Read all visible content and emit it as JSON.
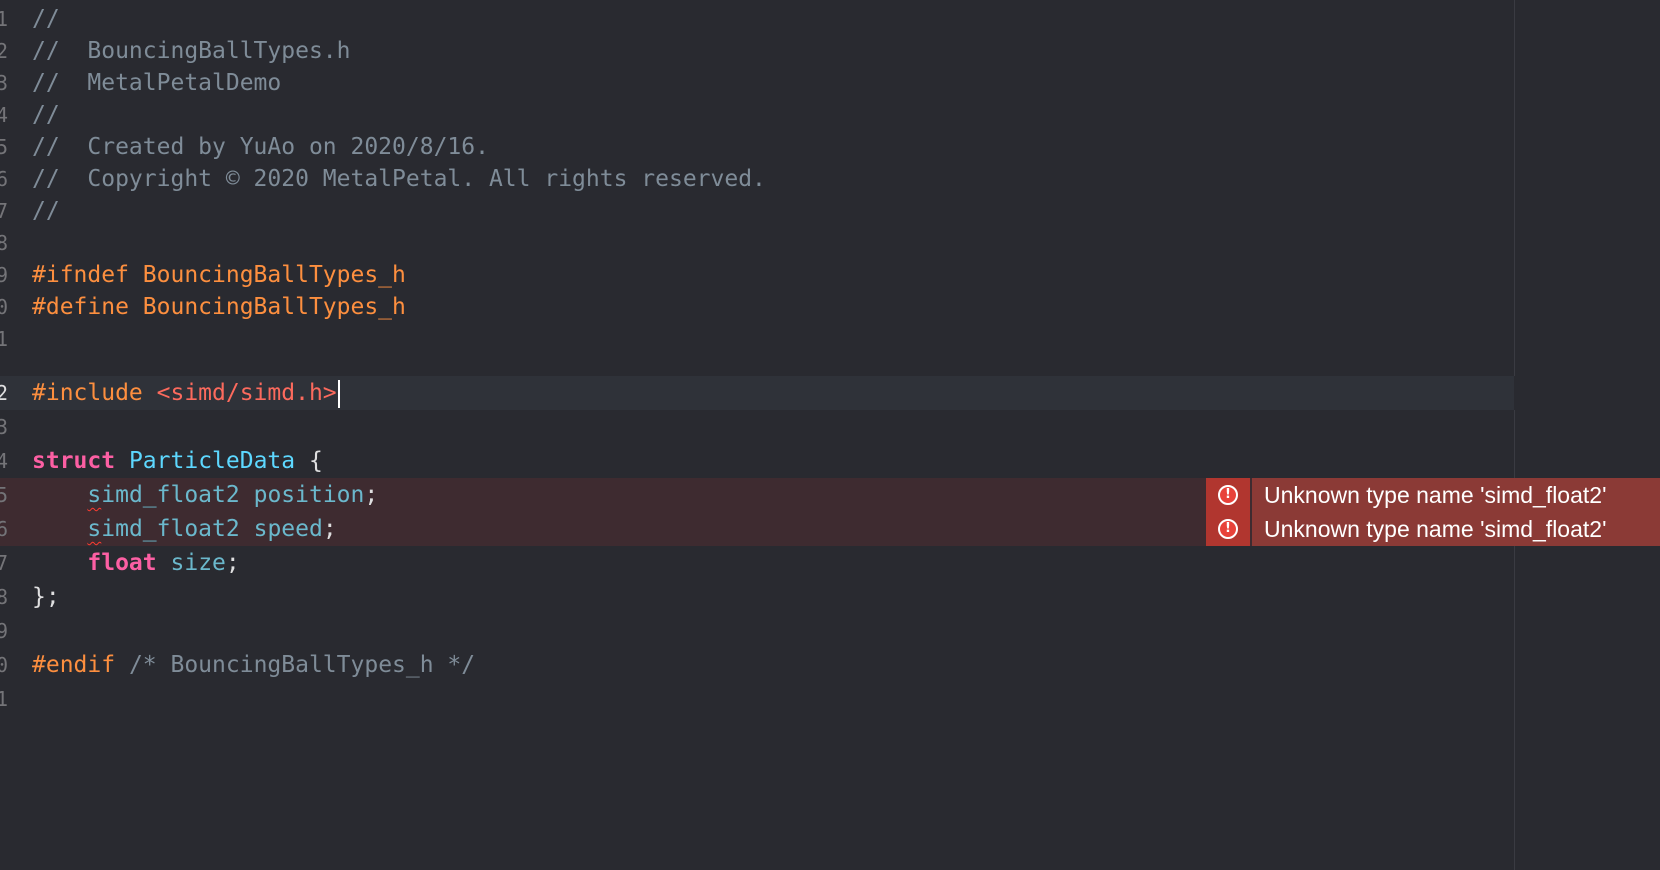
{
  "colors": {
    "background": "#292a30",
    "comment": "#7f8c98",
    "preprocessor": "#fd8f3f",
    "string": "#fc6a5d",
    "keyword": "#fc5fa3",
    "type_declaration": "#5dd8ff",
    "type": "#6bb8cc",
    "plain": "#dfdfe0",
    "error_line": "#3e2b30",
    "error_badge": "#8b3a36"
  },
  "gutter": {
    "numbers": [
      "1",
      "2",
      "3",
      "4",
      "5",
      "6",
      "7",
      "8",
      "9",
      "0",
      "1",
      "2",
      "3",
      "4",
      "5",
      "6",
      "7",
      "8",
      "9",
      "0",
      "1"
    ]
  },
  "lines": {
    "l1": {
      "comment": "//"
    },
    "l2": {
      "comment": "//  BouncingBallTypes.h"
    },
    "l3": {
      "comment": "//  MetalPetalDemo"
    },
    "l4": {
      "comment": "//"
    },
    "l5": {
      "comment": "//  Created by YuAo on 2020/8/16."
    },
    "l6": {
      "comment": "//  Copyright © 2020 MetalPetal. All rights reserved."
    },
    "l7": {
      "comment": "//"
    },
    "l9": {
      "directive": "#ifndef BouncingBallTypes_h"
    },
    "l10": {
      "directive": "#define BouncingBallTypes_h"
    },
    "l12": {
      "directive": "#include ",
      "header": "<simd/simd.h>"
    },
    "l14": {
      "keyword": "struct",
      "name": "ParticleData",
      "brace": " {"
    },
    "l15": {
      "indent": "    ",
      "type_first": "s",
      "type_rest": "imd_float2",
      "field": "position",
      "semi": ";"
    },
    "l16": {
      "indent": "    ",
      "type_first": "s",
      "type_rest": "imd_float2",
      "field": "speed",
      "semi": ";"
    },
    "l17": {
      "indent": "    ",
      "keyword": "float",
      "field": "size",
      "semi": ";"
    },
    "l18": {
      "text": "};"
    },
    "l20": {
      "directive": "#endif",
      "comment": " /* BouncingBallTypes_h */"
    }
  },
  "errors": [
    {
      "message": "Unknown type name 'simd_float2'",
      "icon": "error-icon"
    },
    {
      "message": "Unknown type name 'simd_float2'",
      "icon": "error-icon"
    }
  ],
  "error_icon_glyph": "!"
}
